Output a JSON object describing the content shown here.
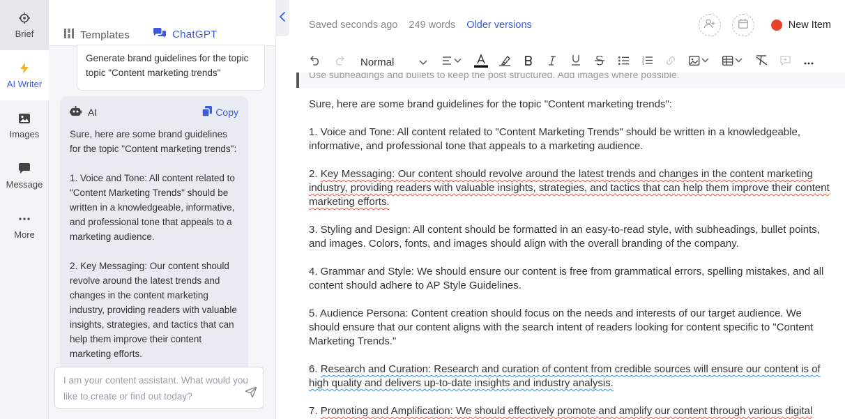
{
  "rail": {
    "items": [
      {
        "label": "Brief",
        "icon": "target-icon"
      },
      {
        "label": "AI Writer",
        "icon": "lightning-icon"
      },
      {
        "label": "Images",
        "icon": "image-icon"
      },
      {
        "label": "Message",
        "icon": "chat-bubble-icon"
      },
      {
        "label": "More",
        "icon": "more-dots-icon"
      }
    ]
  },
  "panel": {
    "tabs": [
      {
        "label": "Templates",
        "icon": "grid-icon"
      },
      {
        "label": "ChatGPT",
        "icon": "chat-bubbles-icon"
      }
    ],
    "user_message": "Generate brand guidelines for the topic topic \"Content marketing trends\"",
    "ai": {
      "name": "AI",
      "copy_label": "Copy",
      "text": "Sure, here are some brand guidelines for the topic \"Content marketing trends\":\n\n1. Voice and Tone: All content related to \"Content Marketing Trends\" should be written in a knowledgeable, informative, and professional tone that appeals to a marketing audience.\n\n2. Key Messaging: Our content should revolve around the latest trends and changes in the content marketing industry, providing readers with valuable insights, strategies, and tactics that can help them improve their content marketing efforts."
    },
    "input_placeholder": "I am your content assistant. What would you like to create or find out today?"
  },
  "editor": {
    "saved_status": "Saved seconds ago",
    "word_count": "249 words",
    "older_versions": "Older versions",
    "new_item": "New Item",
    "status_color": "#e5432d",
    "style_value": "Normal",
    "cut_line": "Use subheadings and bullets to keep the post structured. Add images where possible.",
    "intro": "Sure, here are some brand guidelines for the topic \"Content marketing trends\":",
    "p1": "1. Voice and Tone: All content related to \"Content Marketing Trends\" should be written in a knowledgeable, informative, and professional tone that appeals to a marketing audience.",
    "p2_num": "2. ",
    "p2": "Key Messaging: Our content should revolve around the latest trends and changes in the content marketing industry, providing readers with valuable insights, strategies, and tactics that can help them improve their content marketing efforts.",
    "p3": "3. Styling and Design: All content should be formatted in an easy-to-read style, with subheadings, bullet points, and images. Colors, fonts, and images should align with the overall branding of the company.",
    "p4": "4. Grammar and Style: We should ensure our content is free from grammatical errors, spelling mistakes, and all content should adhere to AP Style Guidelines.",
    "p5": "5. Audience Persona: Content creation should focus on the needs and interests of our target audience. We should ensure that our content aligns with the search intent of readers looking for content specific to \"Content Marketing Trends.\"",
    "p6_num": "6. ",
    "p6": "Research and Curation: Research and curation of content from credible sources will ensure our content is of high quality and delivers up-to-date insights and industry analysis.",
    "p7_num": "7. ",
    "p7": "Promoting and Amplification: We should effectively promote and amplify our content through various digital"
  },
  "colors": {
    "accent": "#3b5bdb",
    "spell_red": "#e05a4a",
    "grammar_blue": "#3d8fd9"
  }
}
